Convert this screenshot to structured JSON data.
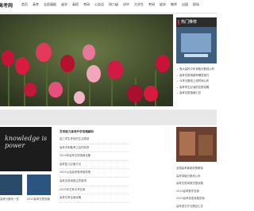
{
  "site": {
    "logo": "高考网"
  },
  "nav": [
    "首页",
    "高考",
    "志愿填报",
    "留学",
    "高招",
    "考研",
    "公务员",
    "四六级",
    "初中",
    "大学生",
    "考研",
    "留学",
    "教师",
    "出国",
    "职场"
  ],
  "sidebar": {
    "heading": "热门推荐",
    "items": [
      "各大高校今年录取分数线公布",
      "高考志愿填报有哪些技巧",
      "今年分数线上线时间公布",
      "高考学生必读的志愿攻略",
      "高考志愿指南汇总"
    ]
  },
  "middle": {
    "title": "艺考能力高考升学攻略解析",
    "items": [
      "高三学生考前的生活规划",
      "高考冲刺备考之后的安排",
      "2025年高考志愿指南全集",
      "高考复习必备方法",
      "2025以及高考报考新政策",
      "高考志愿填报注意事项",
      "2025年艺考大学名单",
      "高考艺考全面攻略"
    ]
  },
  "bottom_left": {
    "blackboard_text": "knowledge is power",
    "caption1": "高考分数线一览",
    "caption2": "2025高考志愿指南"
  },
  "right": {
    "items": [
      "全国高考最新政策解读",
      "高考录取分数线公布",
      "高考志愿填报完整攻略",
      "2025高考数学答案",
      "2025高考英语真题答案",
      "高考语文作文题目汇总"
    ]
  }
}
